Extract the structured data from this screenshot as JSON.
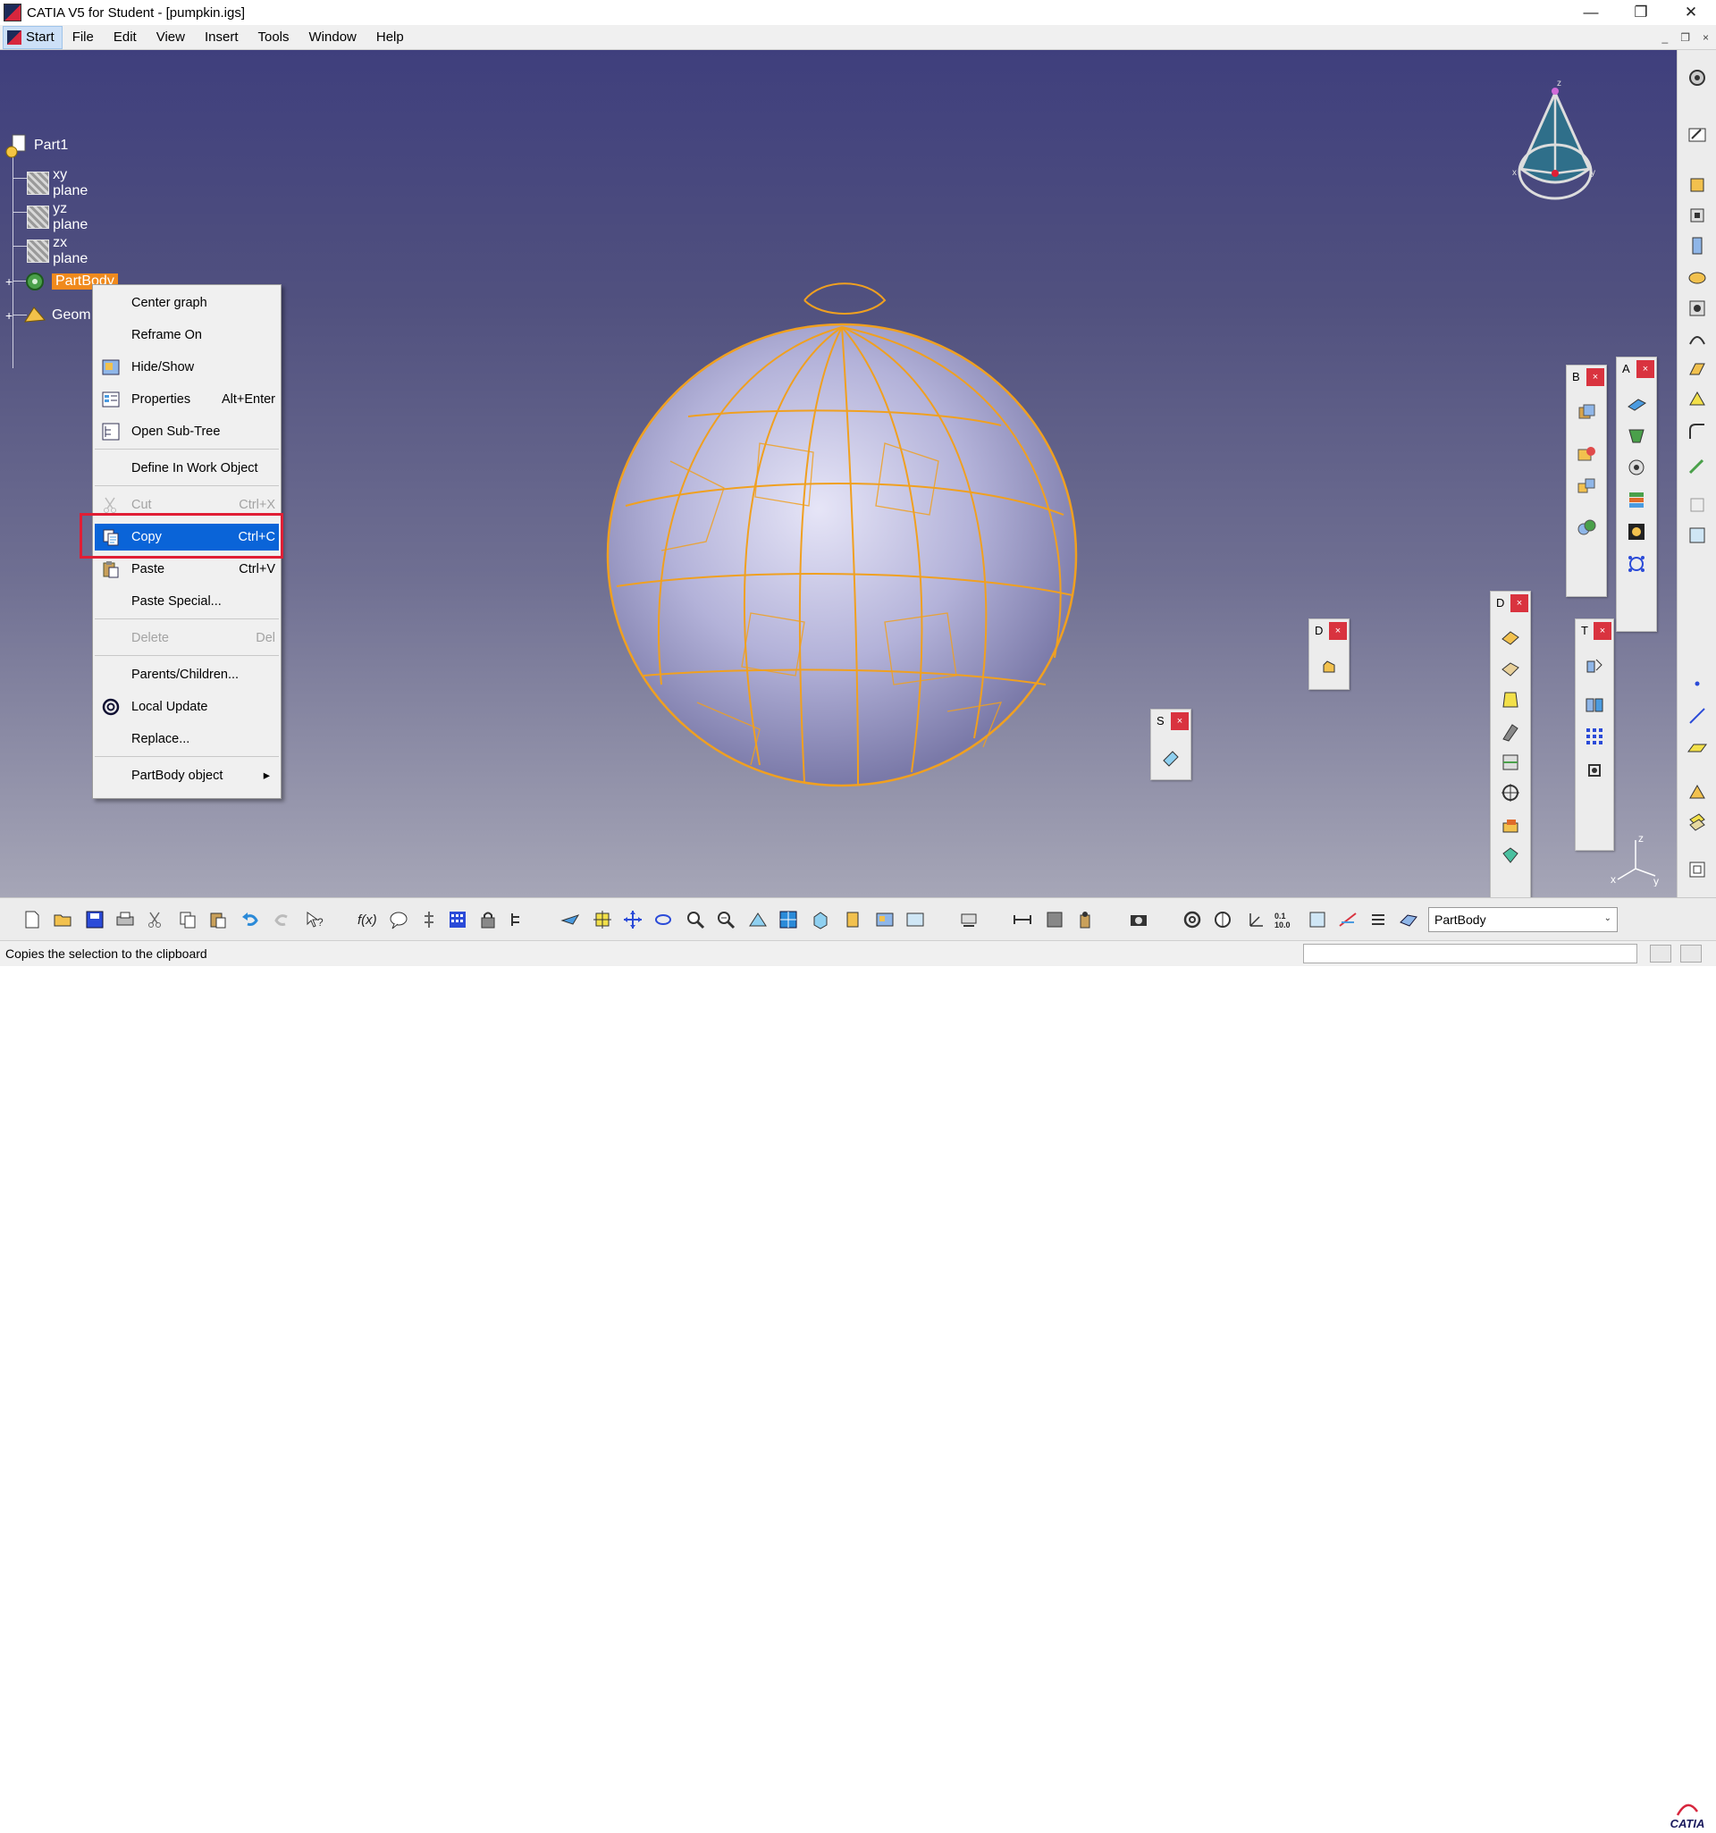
{
  "window": {
    "title": "CATIA V5 for Student - [pumpkin.igs]",
    "minimize_glyph": "—",
    "restore_glyph": "❐",
    "close_glyph": "✕"
  },
  "menubar": {
    "start_label": "Start",
    "items": [
      "File",
      "Edit",
      "View",
      "Insert",
      "Tools",
      "Window",
      "Help"
    ],
    "mdi_glyphs": [
      "_",
      "❐",
      "×"
    ]
  },
  "tree": {
    "root": "Part1",
    "planes": [
      "xy plane",
      "yz plane",
      "zx plane"
    ],
    "partbody": "PartBody",
    "geom": "Geom"
  },
  "context_menu": {
    "items": [
      {
        "label": "Center graph",
        "shortcut": "",
        "state": "normal",
        "icon": ""
      },
      {
        "label": "Reframe On",
        "shortcut": "",
        "state": "normal",
        "icon": ""
      },
      {
        "label": "Hide/Show",
        "shortcut": "",
        "state": "normal",
        "icon": "hide-show-icon"
      },
      {
        "label": "Properties",
        "shortcut": "Alt+Enter",
        "state": "normal",
        "icon": "properties-icon"
      },
      {
        "label": "Open Sub-Tree",
        "shortcut": "",
        "state": "normal",
        "icon": "sub-tree-icon"
      },
      {
        "label": "Define In Work Object",
        "shortcut": "",
        "state": "normal",
        "icon": ""
      },
      {
        "label": "Cut",
        "shortcut": "Ctrl+X",
        "state": "disabled",
        "icon": "scissors-icon"
      },
      {
        "label": "Copy",
        "shortcut": "Ctrl+C",
        "state": "highlighted",
        "icon": "copy-icon"
      },
      {
        "label": "Paste",
        "shortcut": "Ctrl+V",
        "state": "normal",
        "icon": "paste-icon"
      },
      {
        "label": "Paste Special...",
        "shortcut": "",
        "state": "normal",
        "icon": ""
      },
      {
        "label": "Delete",
        "shortcut": "Del",
        "state": "disabled",
        "icon": ""
      },
      {
        "label": "Parents/Children...",
        "shortcut": "",
        "state": "normal",
        "icon": ""
      },
      {
        "label": "Local Update",
        "shortcut": "",
        "state": "normal",
        "icon": "update-icon"
      },
      {
        "label": "Replace...",
        "shortcut": "",
        "state": "normal",
        "icon": ""
      },
      {
        "label": "PartBody object",
        "shortcut": "",
        "state": "submenu",
        "icon": ""
      }
    ],
    "submenu_arrow": "▸"
  },
  "floating_toolbars": [
    {
      "title": "B",
      "close": "×"
    },
    {
      "title": "A",
      "close": "×"
    },
    {
      "title": "D",
      "close": "×"
    },
    {
      "title": "T",
      "close": "×"
    },
    {
      "title": "D",
      "close": "×"
    },
    {
      "title": "S",
      "close": "×"
    }
  ],
  "compass": {
    "x": "x",
    "y": "y",
    "z": "z"
  },
  "axis": {
    "x": "x",
    "y": "y",
    "z": "z"
  },
  "combo": {
    "value": "PartBody",
    "arrow": "⌄"
  },
  "status": {
    "text": "Copies the selection to the clipboard"
  },
  "logo": {
    "text": "CATIA"
  },
  "colors": {
    "highlight": "#0a64d8",
    "selection_orange": "#f08a1d",
    "red_box": "#e01e35",
    "wireframe": "#f0a020",
    "surface": "#b9b8e0"
  }
}
